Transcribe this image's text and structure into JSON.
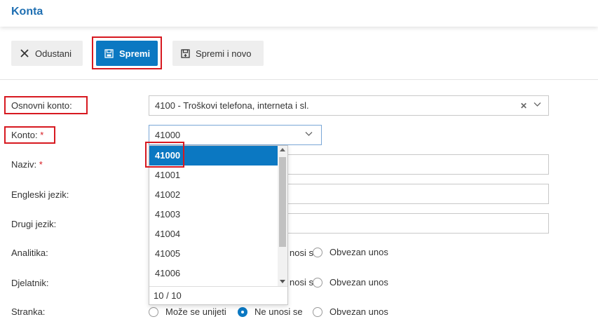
{
  "header": {
    "title": "Konta"
  },
  "toolbar": {
    "cancel_label": "Odustani",
    "save_label": "Spremi",
    "save_new_label": "Spremi i novo"
  },
  "form": {
    "osnovni_konto": {
      "label": "Osnovni konto:",
      "value": "4100 - Troškovi telefona, interneta i sl."
    },
    "konto": {
      "label": "Konto:",
      "required_mark": "*",
      "value": "41000"
    },
    "naziv": {
      "label": "Naziv:",
      "required_mark": "*",
      "value": ""
    },
    "engleski": {
      "label": "Engleski jezik:",
      "value": ""
    },
    "drugi": {
      "label": "Drugi jezik:",
      "value": ""
    },
    "analitika": {
      "label": "Analitika:"
    },
    "djelatnik": {
      "label": "Djelatnik:"
    },
    "stranka": {
      "label": "Stranka:"
    }
  },
  "radio_options": {
    "moze": "Može se unijeti",
    "ne_unosi": "Ne unosi se",
    "ne_unosi_partial": "nosi se",
    "obvezan": "Obvezan unos"
  },
  "dropdown": {
    "items": [
      "41000",
      "41001",
      "41002",
      "41003",
      "41004",
      "41005",
      "41006"
    ],
    "selected": "41000",
    "footer": "10 / 10"
  },
  "colors": {
    "accent": "#0b78c2",
    "title": "#1f6fb2",
    "highlight": "#d71920"
  }
}
